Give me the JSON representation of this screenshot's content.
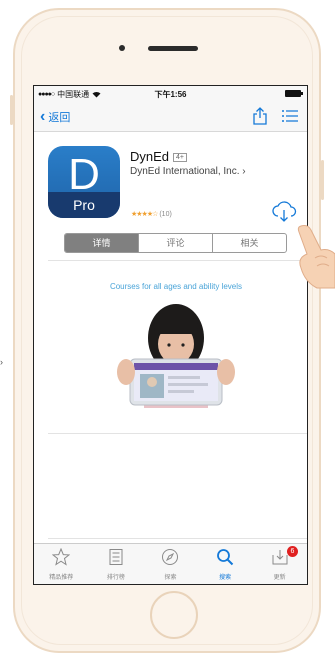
{
  "statusbar": {
    "signal": "●●●●○",
    "carrier": "中国联通",
    "time": "下午1:56"
  },
  "navbar": {
    "back_label": "返回"
  },
  "app": {
    "icon_letter": "D",
    "icon_badge": "Pro",
    "name": "DynEd",
    "age_rating": "4+",
    "developer": "DynEd International, Inc.",
    "developer_chevron": "›",
    "stars": "★★★★☆",
    "rating_count": "(10)"
  },
  "segments": [
    {
      "label": "详情",
      "selected": true
    },
    {
      "label": "评论",
      "selected": false
    },
    {
      "label": "相关",
      "selected": false
    }
  ],
  "banner": {
    "caption": "Courses for all ages and ability levels"
  },
  "tabbar": [
    {
      "label": "精品推荐",
      "icon": "star-icon"
    },
    {
      "label": "排行榜",
      "icon": "list-icon"
    },
    {
      "label": "探索",
      "icon": "compass-icon"
    },
    {
      "label": "搜索",
      "icon": "search-icon",
      "active": true
    },
    {
      "label": "更新",
      "icon": "updates-icon",
      "badge": "6"
    }
  ],
  "colors": {
    "accent": "#1479d8",
    "badge": "#e02020",
    "icon_blue": "#2a7ec9",
    "phone_frame": "#fbf3ea"
  }
}
